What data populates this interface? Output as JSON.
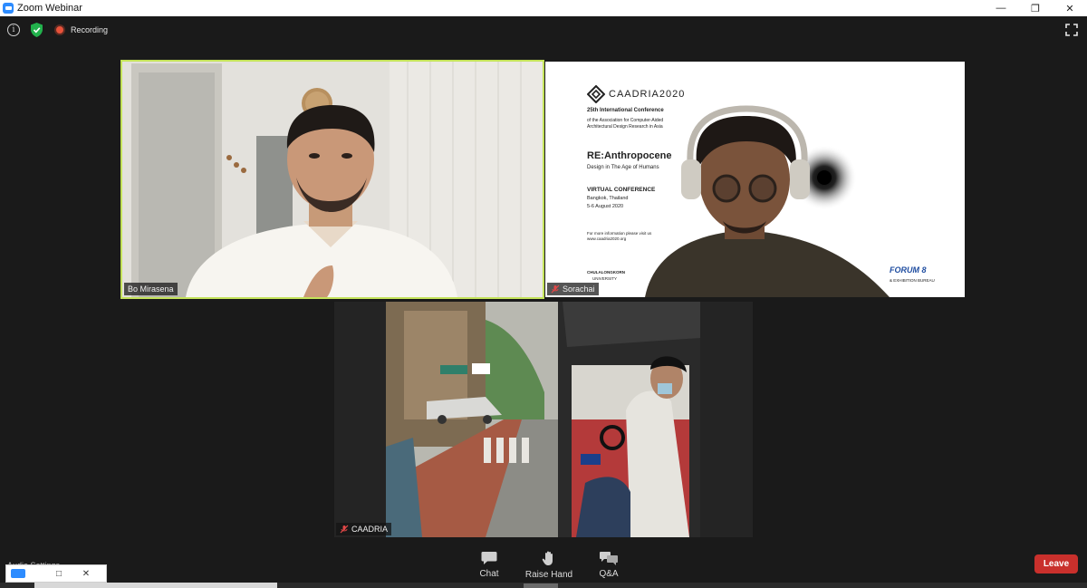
{
  "window": {
    "title": "Zoom Webinar"
  },
  "topbar": {
    "recording_label": "Recording"
  },
  "participants": [
    {
      "name": "Bo Mirasena"
    },
    {
      "name": "Sorachai"
    },
    {
      "name": "CAADRIA"
    }
  ],
  "slide": {
    "brand": "CAADRIA2020",
    "conf_line": "25th International Conference",
    "assoc_line1": "of the Association for Computer-Aided",
    "assoc_line2": "Architectural Design Research in Asia",
    "theme": "RE:Anthropocene",
    "subtheme": "Design in The Age of Humans",
    "venue_type": "VIRTUAL CONFERENCE",
    "city": "Bangkok, Thailand",
    "dates": "5-6 August 2020",
    "info_line1": "For more information please visit us",
    "info_line2": "www.caadria2020.org",
    "university1": "CHULALONGKORN",
    "university2": "UNIVERSITY",
    "sponsor": "FORUM 8",
    "bureau": "& EXHIBITION BUREAU"
  },
  "bottombar": {
    "chat_label": "Chat",
    "raise_hand_label": "Raise Hand",
    "qa_label": "Q&A",
    "leave_label": "Leave"
  },
  "audio_settings_label": "Audio Settings",
  "colors": {
    "accent": "#2d8cff",
    "leave": "#c9302c",
    "active_speaker": "#c4e35a",
    "recording": "#e8523a"
  }
}
